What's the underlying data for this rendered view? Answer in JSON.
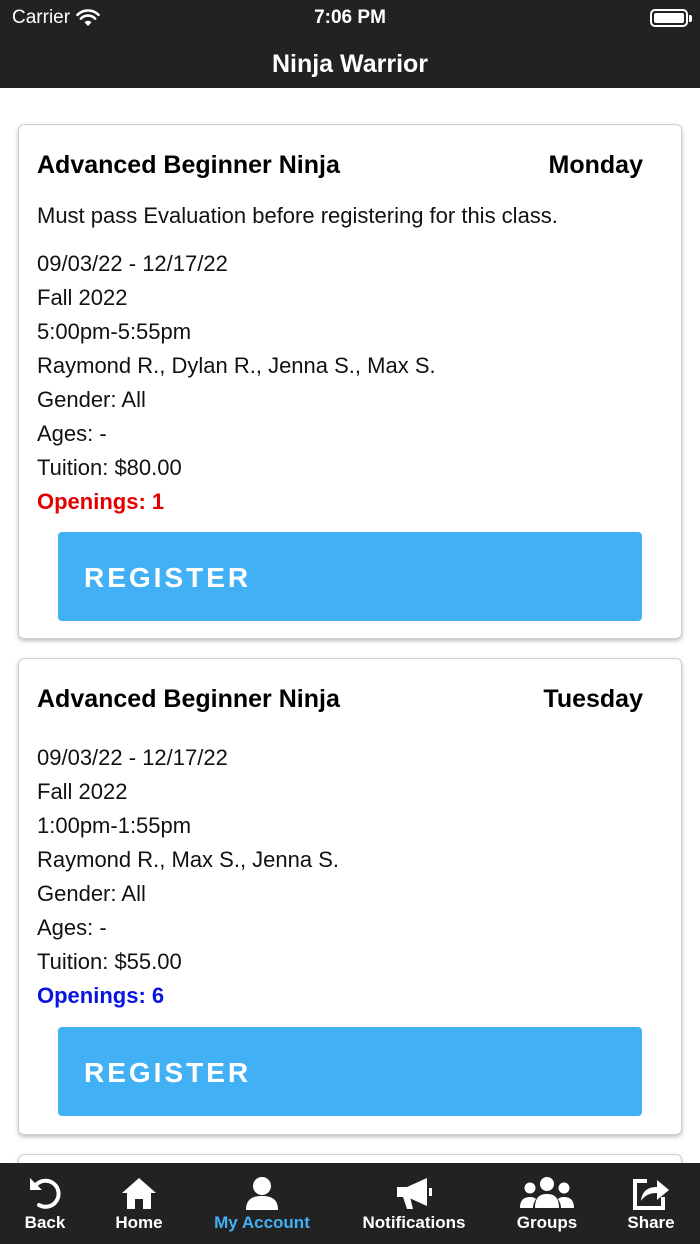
{
  "status_bar": {
    "carrier": "Carrier",
    "time": "7:06 PM"
  },
  "nav": {
    "title": "Ninja Warrior"
  },
  "classes": [
    {
      "name": "Advanced Beginner Ninja",
      "day": "Monday",
      "note": "Must pass Evaluation before registering for this class.",
      "dates": "09/03/22 - 12/17/22",
      "season": "Fall 2022",
      "time": "5:00pm-5:55pm",
      "instructors": "Raymond R., Dylan R., Jenna S., Max S.",
      "gender": "Gender: All",
      "ages": "Ages: -",
      "tuition": "Tuition: $80.00",
      "openings": "Openings: 1",
      "openings_color": "#e30000",
      "button": "REGISTER"
    },
    {
      "name": "Advanced Beginner Ninja",
      "day": "Tuesday",
      "dates": "09/03/22 - 12/17/22",
      "season": "Fall 2022",
      "time": "1:00pm-1:55pm",
      "instructors": "Raymond R., Max S., Jenna S.",
      "gender": "Gender: All",
      "ages": "Ages: -",
      "tuition": "Tuition: $55.00",
      "openings": "Openings: 6",
      "openings_color": "#0a14e0",
      "button": "REGISTER"
    }
  ],
  "tabs": [
    {
      "label": "Back",
      "icon": "back-icon"
    },
    {
      "label": "Home",
      "icon": "home-icon"
    },
    {
      "label": "My Account",
      "icon": "user-icon",
      "active": true
    },
    {
      "label": "Notifications",
      "icon": "megaphone-icon"
    },
    {
      "label": "Groups",
      "icon": "groups-icon"
    },
    {
      "label": "Share",
      "icon": "share-icon"
    }
  ],
  "colors": {
    "bar": "#222222",
    "accent": "#42b0f5"
  }
}
